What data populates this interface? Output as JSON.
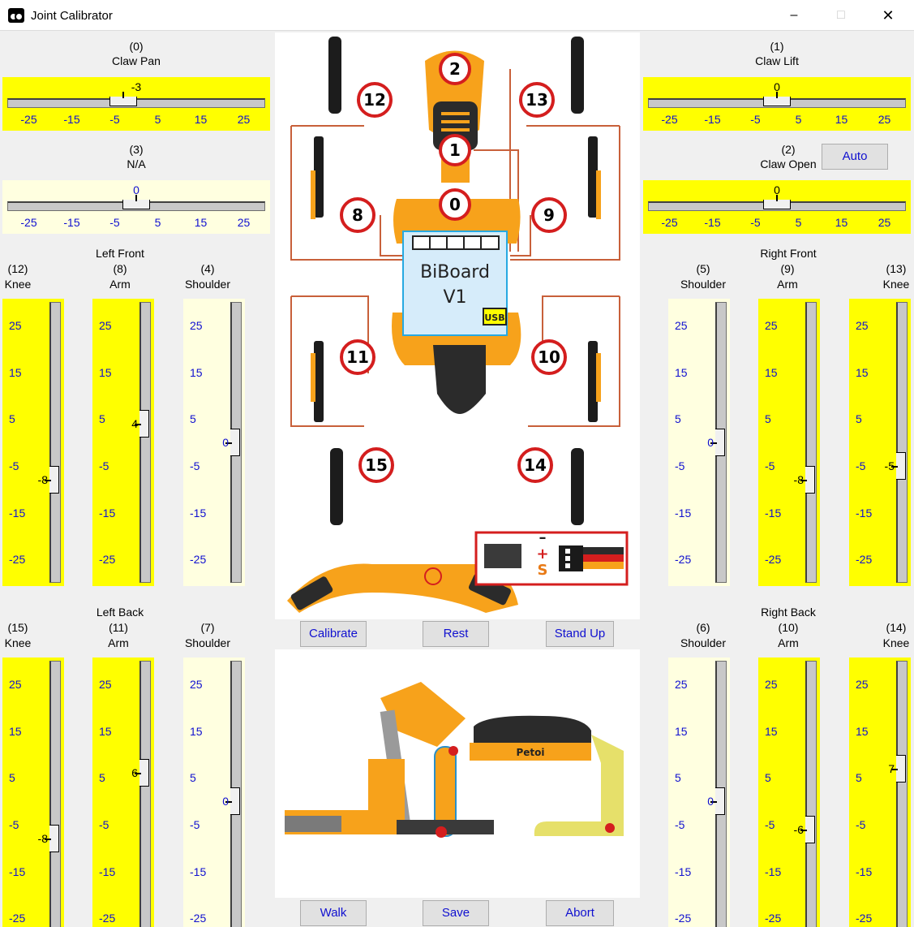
{
  "window": {
    "title": "Joint Calibrator",
    "minimize": "–",
    "maximize": "□",
    "close": "✕"
  },
  "ticks_h": [
    "-25",
    "-15",
    "-5",
    "5",
    "15",
    "25"
  ],
  "ticks_v": [
    "25",
    "15",
    "5",
    "-5",
    "-15",
    "-25"
  ],
  "joints": {
    "j0": {
      "index": "(0)",
      "name": "Claw Pan",
      "value": "-3"
    },
    "j1": {
      "index": "(1)",
      "name": "Claw Lift",
      "value": "0"
    },
    "j2": {
      "index": "(2)",
      "name": "Claw Open",
      "value": "0"
    },
    "j3": {
      "index": "(3)",
      "name": "N/A",
      "value": "0"
    },
    "j12": {
      "index": "(12)",
      "name": "Knee",
      "value": "-8"
    },
    "j8": {
      "index": "(8)",
      "name": "Arm",
      "value": "4"
    },
    "j4": {
      "index": "(4)",
      "name": "Shoulder",
      "value": "0"
    },
    "j5": {
      "index": "(5)",
      "name": "Shoulder",
      "value": "0"
    },
    "j9": {
      "index": "(9)",
      "name": "Arm",
      "value": "-8"
    },
    "j13": {
      "index": "(13)",
      "name": "Knee",
      "value": "-5"
    },
    "j15": {
      "index": "(15)",
      "name": "Knee",
      "value": "-8"
    },
    "j11": {
      "index": "(11)",
      "name": "Arm",
      "value": "6"
    },
    "j7": {
      "index": "(7)",
      "name": "Shoulder",
      "value": "0"
    },
    "j6": {
      "index": "(6)",
      "name": "Shoulder",
      "value": "0"
    },
    "j10": {
      "index": "(10)",
      "name": "Arm",
      "value": "-6"
    },
    "j14": {
      "index": "(14)",
      "name": "Knee",
      "value": "7"
    }
  },
  "groups": {
    "left_front": "Left Front",
    "right_front": "Right Front",
    "left_back": "Left Back",
    "right_back": "Right Back"
  },
  "buttons": {
    "auto": "Auto",
    "calibrate": "Calibrate",
    "rest": "Rest",
    "stand_up": "Stand Up",
    "walk": "Walk",
    "save": "Save",
    "abort": "Abort"
  },
  "diagram": {
    "board_title": "BiBoard",
    "board_version": "V1",
    "usb": "USB",
    "brand": "Petoi",
    "joint_numbers": [
      "0",
      "1",
      "2",
      "8",
      "9",
      "10",
      "11",
      "12",
      "13",
      "14",
      "15"
    ],
    "pin_plus": "+",
    "pin_minus": "–",
    "pin_signal": "S"
  },
  "colors": {
    "active_bg": "#ffff00",
    "inactive_bg": "#ffffe0",
    "tick_blue": "#1010d0",
    "wire": "#c8603a",
    "robot_orange": "#f7a21b",
    "board_blue": "#d6ecfa"
  }
}
